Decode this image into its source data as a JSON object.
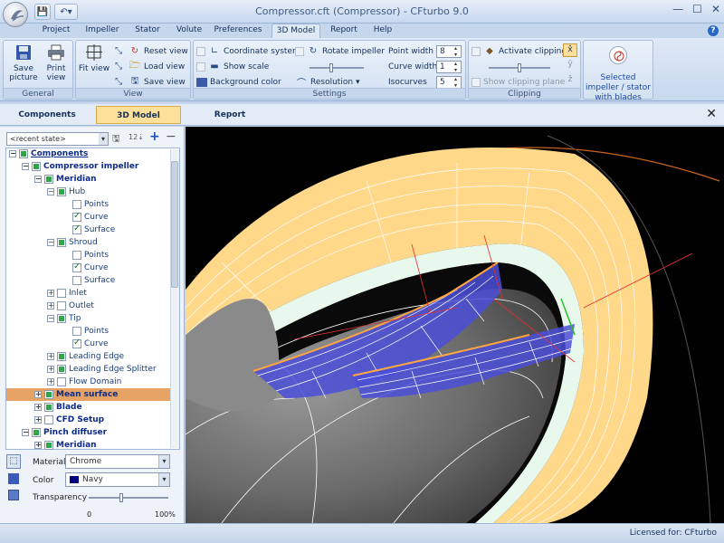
{
  "window": {
    "title": "Compressor.cft (Compressor) - CFturbo 9.0"
  },
  "menu_tabs": [
    {
      "label": "Project"
    },
    {
      "label": "Impeller"
    },
    {
      "label": "Stator"
    },
    {
      "label": "Volute"
    },
    {
      "label": "Preferences"
    },
    {
      "label": "3D Model"
    },
    {
      "label": "Report"
    },
    {
      "label": "Help"
    }
  ],
  "ribbon": {
    "general": {
      "label": "General",
      "save_picture": "Save picture",
      "print_view": "Print view"
    },
    "view": {
      "label": "View",
      "fit_view": "Fit view",
      "reset_view": "Reset view",
      "load_view": "Load view",
      "save_view": "Save view"
    },
    "settings": {
      "label": "Settings",
      "coordinate_system": "Coordinate system",
      "show_scale": "Show scale",
      "background_color": "Background color",
      "rotate_impeller": "Rotate impeller",
      "resolution": "Resolution",
      "point_width_label": "Point width",
      "point_width_value": "8",
      "curve_width_label": "Curve width",
      "curve_width_value": "1",
      "isocurves_label": "Isocurves",
      "isocurves_value": "5"
    },
    "clipping": {
      "label": "Clipping",
      "activate_clipping": "Activate clipping",
      "show_clipping_plane": "Show clipping plane"
    },
    "selected": {
      "label": "Selected impeller / stator with blades"
    }
  },
  "view_tabs": [
    {
      "label": "Components"
    },
    {
      "label": "3D Model"
    },
    {
      "label": "Report"
    }
  ],
  "left_panel": {
    "state_combo": "<recent state>",
    "tree": [
      {
        "label": "Components"
      },
      {
        "label": "Compressor impeller"
      },
      {
        "label": "Meridian"
      },
      {
        "label": "Hub"
      },
      {
        "label": "Points"
      },
      {
        "label": "Curve"
      },
      {
        "label": "Surface"
      },
      {
        "label": "Shroud"
      },
      {
        "label": "Points"
      },
      {
        "label": "Curve"
      },
      {
        "label": "Surface"
      },
      {
        "label": "Inlet"
      },
      {
        "label": "Outlet"
      },
      {
        "label": "Tip"
      },
      {
        "label": "Points"
      },
      {
        "label": "Curve"
      },
      {
        "label": "Leading Edge"
      },
      {
        "label": "Leading Edge Splitter"
      },
      {
        "label": "Flow Domain"
      },
      {
        "label": "Mean surface"
      },
      {
        "label": "Blade"
      },
      {
        "label": "CFD Setup"
      },
      {
        "label": "Pinch diffuser"
      },
      {
        "label": "Meridian"
      }
    ],
    "material_label": "Material",
    "material_value": "Chrome",
    "color_label": "Color",
    "color_value": "Navy",
    "color_swatch": "#000080",
    "transparency_label": "Transparency",
    "transparency_min": "0",
    "transparency_max": "100%",
    "transparency_level": 0.4
  },
  "status": {
    "license": "Licensed for: CFturbo"
  },
  "colors": {
    "accent_tab": "#fde09a",
    "highlight_row": "#e6a363",
    "blade": "#4b4fd8",
    "shroud_band": "#ffd88a"
  }
}
